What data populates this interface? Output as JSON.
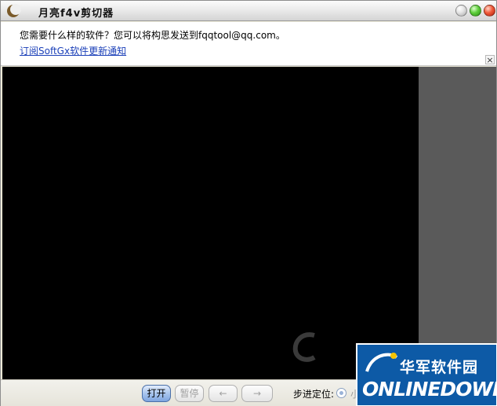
{
  "window": {
    "title": "月亮f4v剪切器"
  },
  "infobar": {
    "message": "您需要什么样的软件？您可以将构思发送到fqqtool@qq.com。",
    "link": "订阅SoftGx软件更新通知",
    "close_glyph": "×"
  },
  "controls": {
    "open_label": "打开",
    "pause_label": "暂停",
    "prev_label": "←",
    "next_label": "→",
    "step_label": "步进定位:",
    "step_option": "小"
  },
  "watermark": {
    "logo_cn": "华军软件园",
    "logo_en": "ONLINEDOWN.NET"
  },
  "icons": {
    "app": "crescent-moon-icon",
    "minimize": "minimize-icon",
    "maximize": "maximize-icon",
    "close": "close-icon"
  },
  "colors": {
    "video_bg": "#000000",
    "side_panel": "#5a5a5a",
    "link": "#1a3fb8",
    "logo_bg": "#0d5aa6"
  }
}
